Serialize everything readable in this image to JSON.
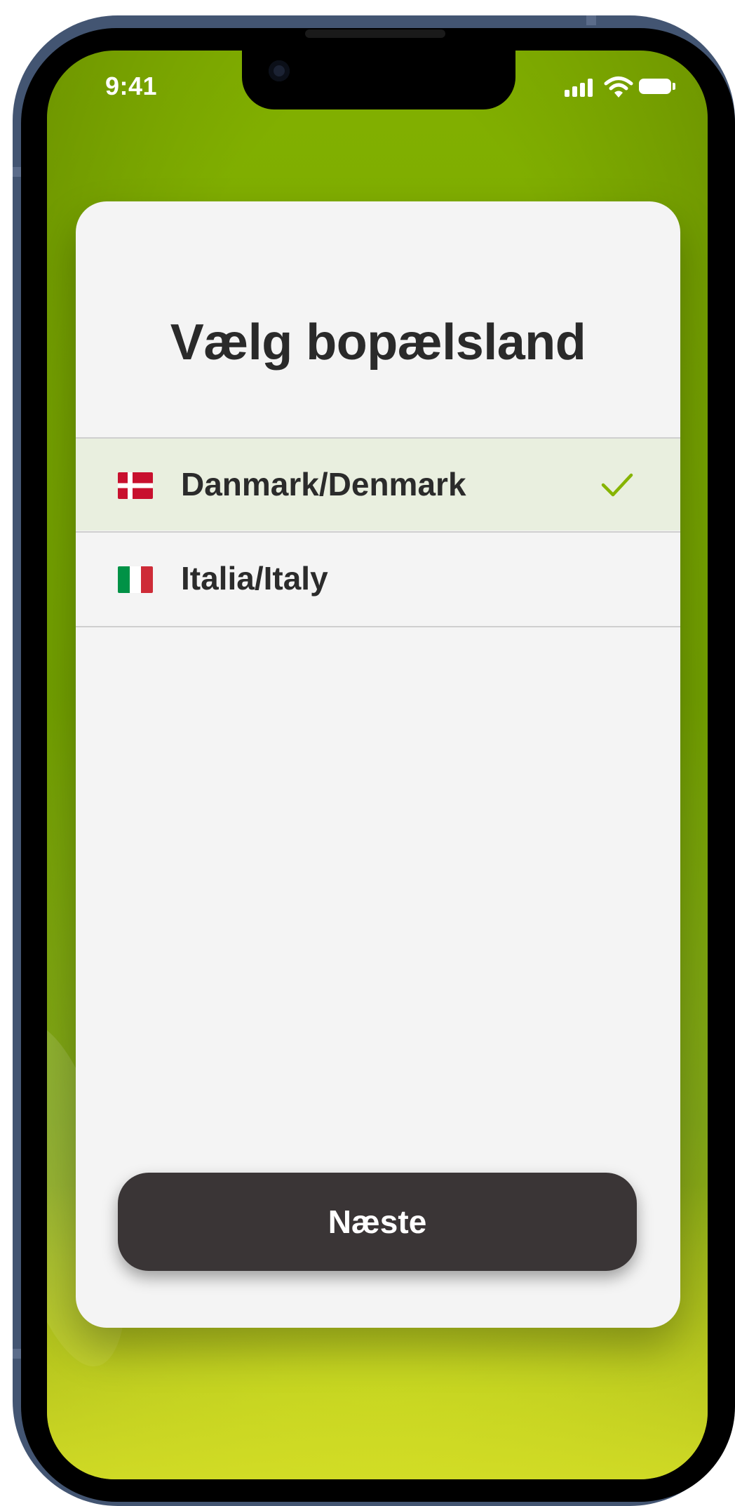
{
  "status_bar": {
    "time": "9:41",
    "icons": [
      "signal-icon",
      "wifi-icon",
      "battery-icon"
    ]
  },
  "card": {
    "title": "Vælg bopælsland",
    "countries": [
      {
        "label": "Danmark/Denmark",
        "flag": "denmark-flag-icon",
        "selected": true
      },
      {
        "label": "Italia/Italy",
        "flag": "italy-flag-icon",
        "selected": false
      }
    ],
    "next_label": "Næste"
  },
  "colors": {
    "background_green": "#82b000",
    "selected_row": "#e9efdf",
    "check": "#86b400",
    "button": "#3a3536"
  }
}
